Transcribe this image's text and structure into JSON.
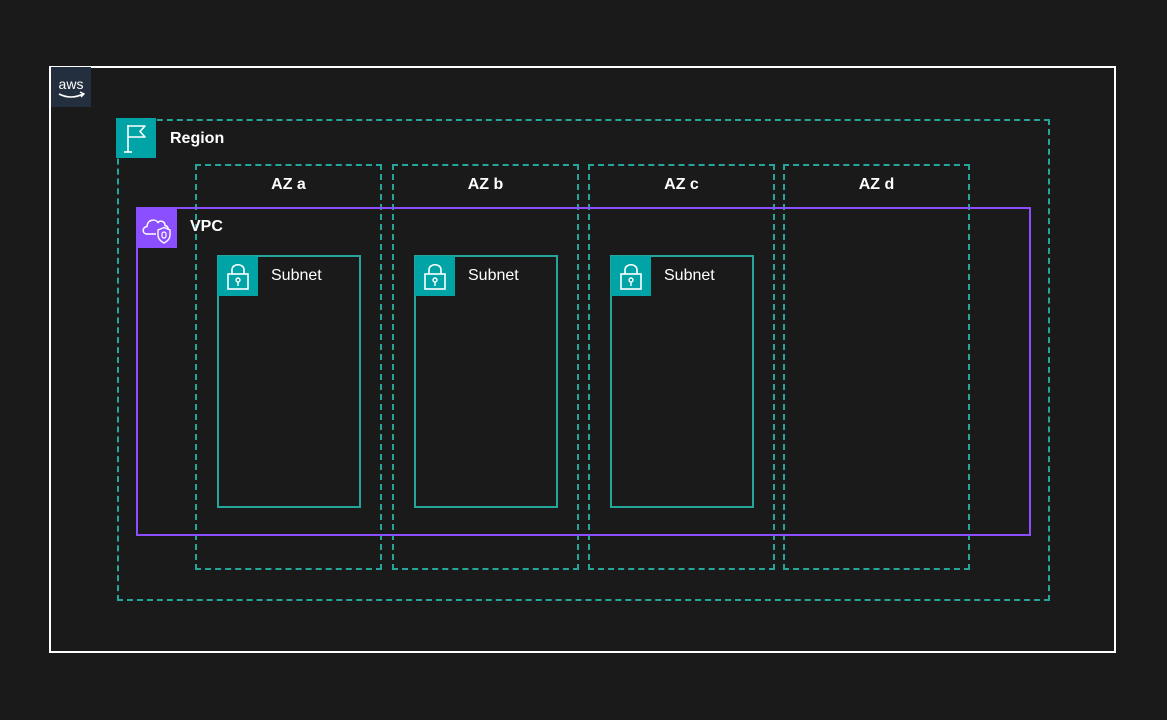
{
  "diagram": {
    "aws_logo": {
      "text": "aws",
      "icon": "aws-logo-icon"
    },
    "region": {
      "label": "Region",
      "icon": "region-flag-icon"
    },
    "availability_zones": [
      {
        "label": "AZ a"
      },
      {
        "label": "AZ b"
      },
      {
        "label": "AZ c"
      },
      {
        "label": "AZ d"
      }
    ],
    "vpc": {
      "label": "VPC",
      "icon": "vpc-cloud-icon"
    },
    "subnets": [
      {
        "label": "Subnet",
        "icon": "subnet-lock-icon"
      },
      {
        "label": "Subnet",
        "icon": "subnet-lock-icon"
      },
      {
        "label": "Subnet",
        "icon": "subnet-lock-icon"
      }
    ],
    "colors": {
      "background": "#1a1a1a",
      "aws_cloud_border": "#ffffff",
      "region_teal": "#26a69a",
      "icon_teal": "#00a4a6",
      "vpc_purple": "#8c4fff",
      "aws_logo_bg": "#232f3e"
    }
  }
}
